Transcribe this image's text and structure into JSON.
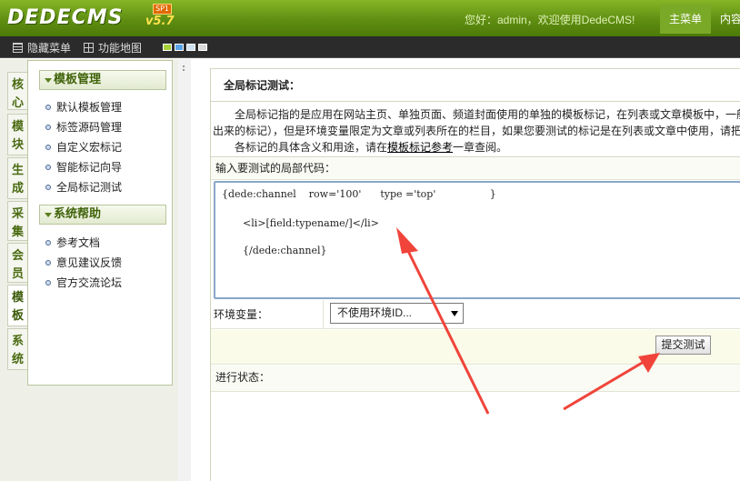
{
  "header": {
    "logo_text": "DEDECMS",
    "version": "v5.7",
    "sp_badge": "SP1",
    "greeting": "您好：admin，欢迎使用DedeCMS!",
    "nav": [
      "主菜单",
      "内容"
    ]
  },
  "toolbar": {
    "hide_menu": "隐藏菜单",
    "site_map": "功能地图",
    "swatch_colors": [
      "#a6d13a",
      "#5aa3e6",
      "#cfe0ef",
      "#d9d9d9"
    ]
  },
  "vertical_tabs": [
    {
      "label": "核心",
      "active": false
    },
    {
      "label": "模块",
      "active": false
    },
    {
      "label": "生成",
      "active": false
    },
    {
      "label": "采集",
      "active": false
    },
    {
      "label": "会员",
      "active": false
    },
    {
      "label": "模板",
      "active": true
    },
    {
      "label": "系统",
      "active": false
    }
  ],
  "sidebar": {
    "sections": [
      {
        "title": "模板管理",
        "items": [
          "默认模板管理",
          "标签源码管理",
          "自定义宏标记",
          "智能标记向导",
          "全局标记测试"
        ]
      },
      {
        "title": "系统帮助",
        "items": [
          "参考文档",
          "意见建议反馈",
          "官方交流论坛"
        ]
      }
    ]
  },
  "main": {
    "title": "全局标记测试：",
    "desc_line1": "全局标记指的是应用在网站主页、单独页面、频道封面使用的单独的模板标记，在列表或文章模板中，一般",
    "desc_line2": "出来的标记），但是环境变量限定为文章或列表所在的栏目，如果您要测试的标记是在列表或文章中使用，请把",
    "desc_line3_prefix": "各标记的具体含义和用途，请在",
    "desc_line3_link": "模板标记参考",
    "desc_line3_suffix": "一章查阅。",
    "input_label": "输入要测试的局部代码：",
    "code_lines": [
      "{dede:channel    row='100'      type ='top'                 }",
      "<li>[field:typename/]</li>",
      "{/dede:channel}"
    ],
    "env_label": "环境变量：",
    "env_select_value": "不使用环境ID...",
    "submit_label": "提交测试",
    "status_label": "进行状态："
  },
  "annotation_color": "#f0443a"
}
